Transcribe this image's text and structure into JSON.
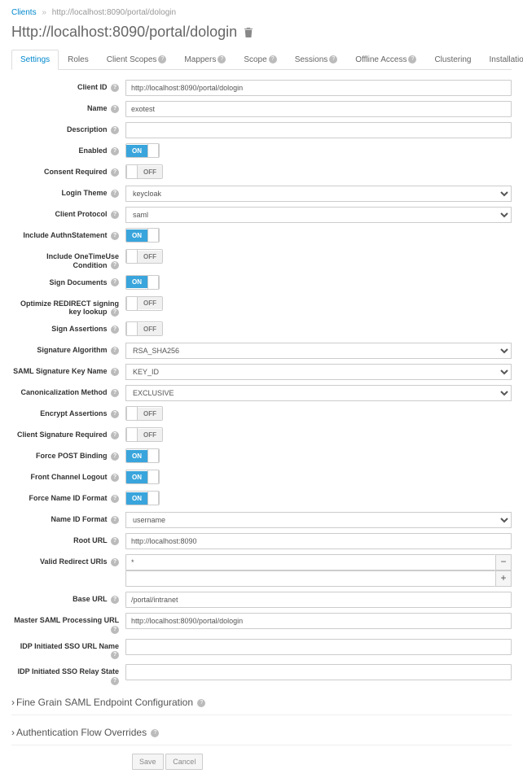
{
  "breadcrumb": {
    "root": "Clients",
    "current": "http://localhost:8090/portal/dologin"
  },
  "page_title": "Http://localhost:8090/portal/dologin",
  "tabs": [
    {
      "label": "Settings",
      "active": true,
      "help": false
    },
    {
      "label": "Roles",
      "help": false
    },
    {
      "label": "Client Scopes",
      "help": true
    },
    {
      "label": "Mappers",
      "help": true
    },
    {
      "label": "Scope",
      "help": true
    },
    {
      "label": "Sessions",
      "help": true
    },
    {
      "label": "Offline Access",
      "help": true
    },
    {
      "label": "Clustering",
      "help": false
    },
    {
      "label": "Installation",
      "help": true
    }
  ],
  "fields": [
    {
      "label": "Client ID",
      "type": "text",
      "value": "http://localhost:8090/portal/dologin",
      "help": true
    },
    {
      "label": "Name",
      "type": "text",
      "value": "exotest",
      "help": true
    },
    {
      "label": "Description",
      "type": "text",
      "value": "",
      "help": true
    },
    {
      "label": "Enabled",
      "type": "toggle",
      "value": "on",
      "help": true
    },
    {
      "label": "Consent Required",
      "type": "toggle",
      "value": "off",
      "help": true
    },
    {
      "label": "Login Theme",
      "type": "select",
      "value": "keycloak",
      "help": true
    },
    {
      "label": "Client Protocol",
      "type": "select",
      "value": "saml",
      "help": true
    },
    {
      "label": "Include AuthnStatement",
      "type": "toggle",
      "value": "on",
      "help": true
    },
    {
      "label": "Include OneTimeUse Condition",
      "type": "toggle",
      "value": "off",
      "help": true
    },
    {
      "label": "Sign Documents",
      "type": "toggle",
      "value": "on",
      "help": true
    },
    {
      "label": "Optimize REDIRECT signing key lookup",
      "type": "toggle",
      "value": "off",
      "help": true
    },
    {
      "label": "Sign Assertions",
      "type": "toggle",
      "value": "off",
      "help": true
    },
    {
      "label": "Signature Algorithm",
      "type": "select",
      "value": "RSA_SHA256",
      "help": true
    },
    {
      "label": "SAML Signature Key Name",
      "type": "select",
      "value": "KEY_ID",
      "help": true
    },
    {
      "label": "Canonicalization Method",
      "type": "select",
      "value": "EXCLUSIVE",
      "help": true
    },
    {
      "label": "Encrypt Assertions",
      "type": "toggle",
      "value": "off",
      "help": true
    },
    {
      "label": "Client Signature Required",
      "type": "toggle",
      "value": "off",
      "help": true
    },
    {
      "label": "Force POST Binding",
      "type": "toggle",
      "value": "on",
      "help": true
    },
    {
      "label": "Front Channel Logout",
      "type": "toggle",
      "value": "on",
      "help": true
    },
    {
      "label": "Force Name ID Format",
      "type": "toggle",
      "value": "on",
      "help": true
    },
    {
      "label": "Name ID Format",
      "type": "select",
      "value": "username",
      "help": true
    },
    {
      "label": "Root URL",
      "type": "text",
      "value": "http://localhost:8090",
      "help": true
    },
    {
      "label": "Valid Redirect URIs",
      "type": "redirect",
      "value": "*",
      "help": true
    },
    {
      "label": "Base URL",
      "type": "text",
      "value": "/portal/intranet",
      "help": true
    },
    {
      "label": "Master SAML Processing URL",
      "type": "text",
      "value": "http://localhost:8090/portal/dologin",
      "help": true
    },
    {
      "label": "IDP Initiated SSO URL Name",
      "type": "text",
      "value": "",
      "help": true
    },
    {
      "label": "IDP Initiated SSO Relay State",
      "type": "text",
      "value": "",
      "help": true
    }
  ],
  "sections": [
    {
      "label": "Fine Grain SAML Endpoint Configuration"
    },
    {
      "label": "Authentication Flow Overrides"
    }
  ],
  "buttons": {
    "save": "Save",
    "cancel": "Cancel"
  },
  "toggle_text": {
    "on": "ON",
    "off": "OFF"
  },
  "glyphs": {
    "minus": "−",
    "plus": "+",
    "chevron": "›"
  }
}
